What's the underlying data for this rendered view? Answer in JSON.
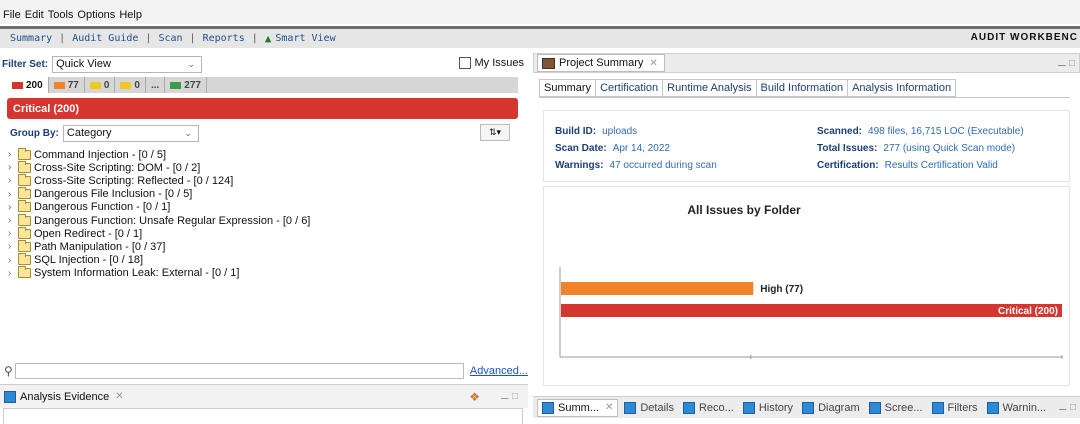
{
  "menu": [
    "File",
    "Edit",
    "Tools",
    "Options",
    "Help"
  ],
  "nav": {
    "items": [
      "Summary",
      "Audit Guide",
      "Scan",
      "Reports"
    ],
    "smart_view": "Smart View",
    "brand": "AUDIT WORKBENC"
  },
  "filter": {
    "label": "Filter Set:",
    "value": "Quick View",
    "my_issues_label": "My Issues"
  },
  "priority_tabs": [
    {
      "count": "200",
      "color": "#d5362f"
    },
    {
      "count": "77",
      "color": "#f0822a"
    },
    {
      "count": "0",
      "color": "#f3c623"
    },
    {
      "count": "0",
      "color": "#f3c623"
    },
    {
      "count": "...",
      "color": null
    },
    {
      "count": "277",
      "color": "#3f9b48"
    }
  ],
  "critical_bar": "Critical (200)",
  "group_by": {
    "label": "Group By:",
    "value": "Category"
  },
  "categories": [
    "Command Injection - [0 / 5]",
    "Cross-Site Scripting: DOM - [0 / 2]",
    "Cross-Site Scripting: Reflected - [0 / 124]",
    "Dangerous File Inclusion - [0 / 5]",
    "Dangerous Function - [0 / 1]",
    "Dangerous Function: Unsafe Regular Expression - [0 / 6]",
    "Open Redirect - [0 / 1]",
    "Path Manipulation - [0 / 37]",
    "SQL Injection - [0 / 18]",
    "System Information Leak: External - [0 / 1]"
  ],
  "advanced_link": "Advanced...",
  "analysis_evidence": "Analysis Evidence",
  "project_summary": {
    "tab_title": "Project Summary",
    "sub_tabs": [
      "Summary",
      "Certification",
      "Runtime Analysis",
      "Build Information",
      "Analysis Information"
    ],
    "build_id": {
      "label": "Build ID:",
      "value": "uploads"
    },
    "scan_date": {
      "label": "Scan Date:",
      "value": "Apr 14, 2022"
    },
    "warnings": {
      "label": "Warnings:",
      "value": "47 occurred during scan"
    },
    "scanned": {
      "label": "Scanned:",
      "value": "498 files, 16,715 LOC (Executable)"
    },
    "total_issues": {
      "label": "Total Issues:",
      "value": "277 (using Quick Scan mode)"
    },
    "certification": {
      "label": "Certification:",
      "value": "Results Certification Valid"
    }
  },
  "chart_data": {
    "type": "bar",
    "orientation": "horizontal",
    "title": "All Issues by Folder",
    "categories": [
      "High",
      "Critical"
    ],
    "values": [
      77,
      200
    ],
    "labels": [
      "High (77)",
      "Critical (200)"
    ],
    "colors": [
      "#f0822a",
      "#d5362f"
    ],
    "xlim": [
      0,
      200
    ]
  },
  "bottom_tabs": [
    "Summ...",
    "Details",
    "Reco...",
    "History",
    "Diagram",
    "Scree...",
    "Filters",
    "Warnin..."
  ]
}
